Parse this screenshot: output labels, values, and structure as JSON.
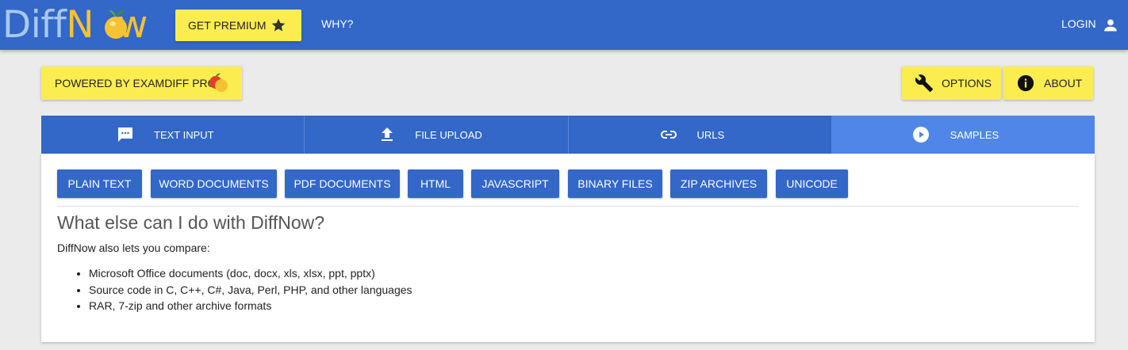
{
  "header": {
    "logo_part1": "Diff",
    "logo_part2": "N",
    "logo_part3": "w",
    "premium_label": "GET PREMIUM",
    "why_label": "WHY?",
    "login_label": "LOGIN"
  },
  "toolbar": {
    "powered_label": "POWERED BY EXAMDIFF PRO",
    "options_label": "OPTIONS",
    "about_label": "ABOUT"
  },
  "tabs": [
    {
      "label": "TEXT INPUT",
      "icon": "chat-icon"
    },
    {
      "label": "FILE UPLOAD",
      "icon": "upload-icon"
    },
    {
      "label": "URLS",
      "icon": "link-icon"
    },
    {
      "label": "SAMPLES",
      "icon": "play-circle-icon",
      "active": true
    }
  ],
  "samples": [
    {
      "label": "PLAIN TEXT"
    },
    {
      "label": "WORD DOCUMENTS"
    },
    {
      "label": "PDF DOCUMENTS"
    },
    {
      "label": "HTML"
    },
    {
      "label": "JAVASCRIPT"
    },
    {
      "label": "BINARY FILES"
    },
    {
      "label": "ZIP ARCHIVES"
    },
    {
      "label": "UNICODE"
    }
  ],
  "info": {
    "heading": "What else can I do with DiffNow?",
    "intro": "DiffNow also lets you compare:",
    "items": [
      "Microsoft Office documents (doc, docx, xls, xlsx, ppt, pptx)",
      "Source code in C, C++, C#, Java, Perl, PHP, and other languages",
      "RAR, 7-zip and other archive formats"
    ]
  },
  "colors": {
    "primary": "#3367c8",
    "active_tab": "#4f86e8",
    "yellow": "#fbed50"
  }
}
